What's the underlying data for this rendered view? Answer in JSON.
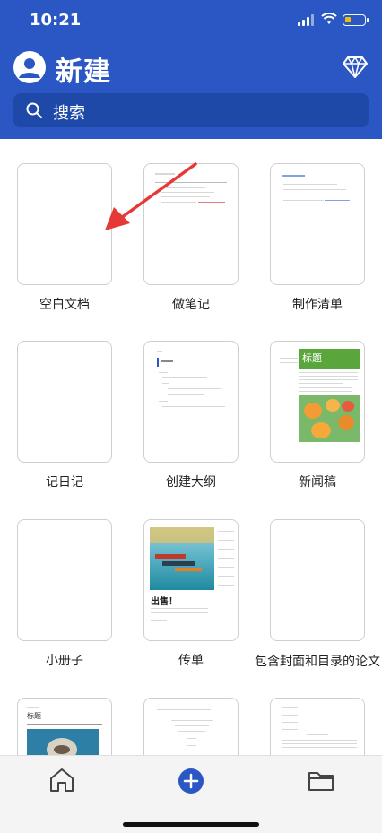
{
  "status_bar": {
    "time": "10:21"
  },
  "header": {
    "title": "新建"
  },
  "search": {
    "placeholder": "搜索"
  },
  "templates": [
    {
      "label": "空白文档"
    },
    {
      "label": "做笔记"
    },
    {
      "label": "制作清单"
    },
    {
      "label": "记日记"
    },
    {
      "label": "创建大纲"
    },
    {
      "label": "新闻稿"
    },
    {
      "label": "小册子"
    },
    {
      "label": "传单"
    },
    {
      "label": "包含封面和目录的论文"
    }
  ],
  "thumbnails": {
    "newsletter_heading": "标题",
    "flyer_heading": "出售！",
    "report_heading": "标题"
  },
  "colors": {
    "header_bg": "#2b57c4",
    "search_bg": "#1f49a8",
    "accent_blue": "#2b57c4",
    "arrow_red": "#e53935",
    "newsletter_green": "#5aa53c"
  },
  "icons": {
    "premium": "diamond-icon",
    "search": "search-icon",
    "home": "home-icon",
    "new": "plus-icon",
    "files": "folder-icon"
  }
}
